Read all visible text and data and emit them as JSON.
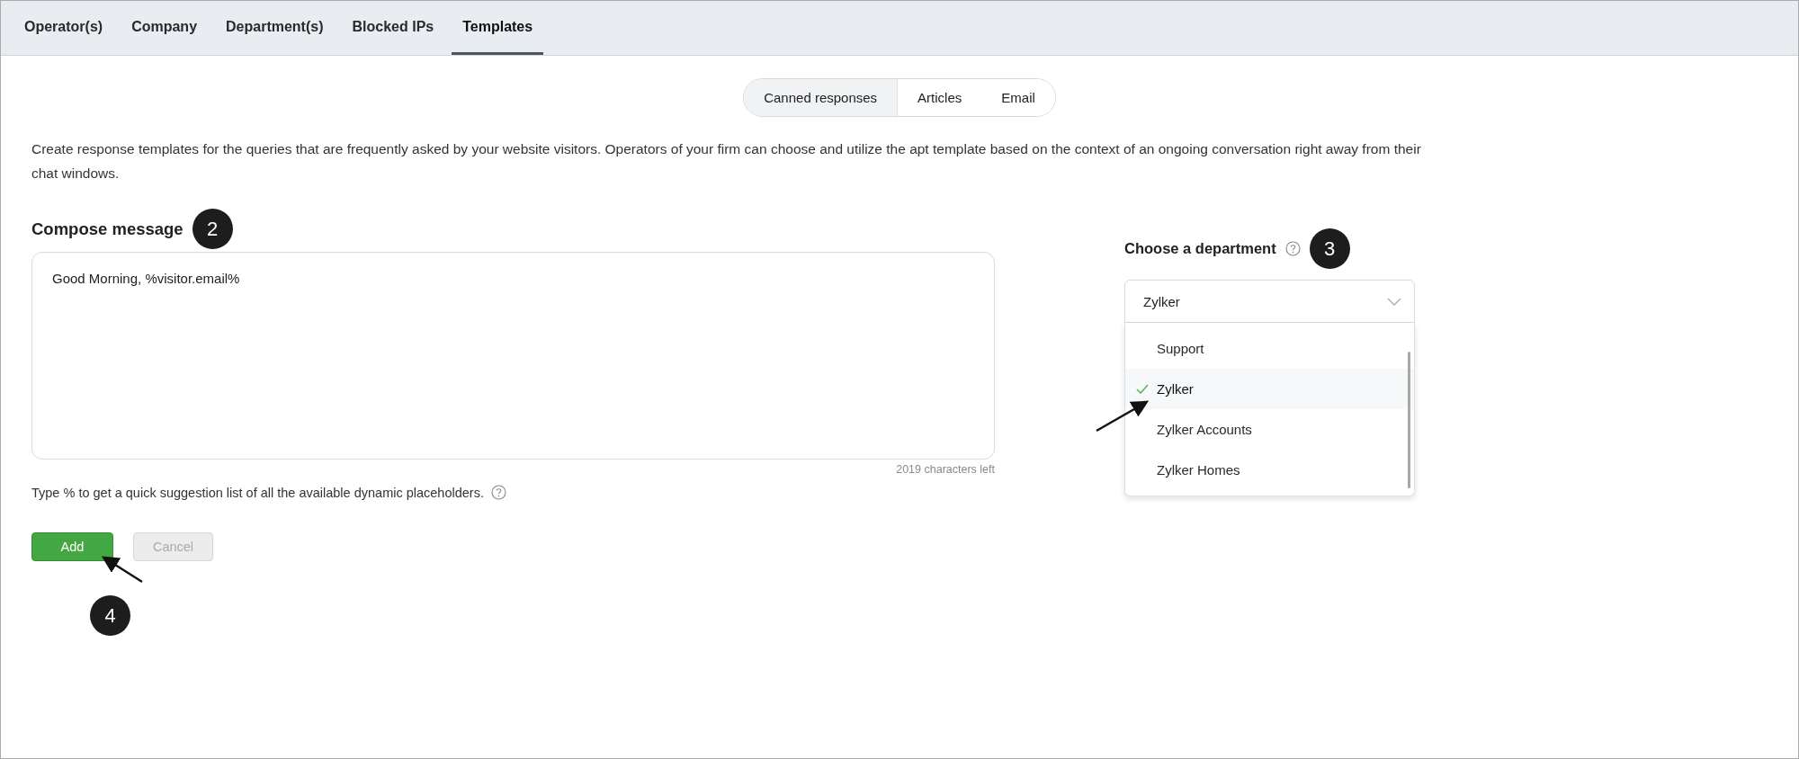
{
  "tabs": [
    {
      "label": "Operator(s)",
      "selected": false
    },
    {
      "label": "Company",
      "selected": false
    },
    {
      "label": "Department(s)",
      "selected": false
    },
    {
      "label": "Blocked IPs",
      "selected": false
    },
    {
      "label": "Templates",
      "selected": true
    }
  ],
  "segments": [
    {
      "label": "Canned responses",
      "selected": true
    },
    {
      "label": "Articles",
      "selected": false
    },
    {
      "label": "Email",
      "selected": false
    }
  ],
  "description": "Create response templates for the queries that are frequently asked by your website visitors. Operators of your firm can choose and utilize the apt template based on the context of an ongoing conversation right away from their chat windows.",
  "compose": {
    "title": "Compose message",
    "badge": "2",
    "value": "Good Morning, %visitor.email%",
    "chars_left": "2019 characters left",
    "hint": "Type % to get a quick suggestion list of all the available dynamic placeholders."
  },
  "buttons": [
    {
      "label": "Add",
      "kind": "primary",
      "disabled": false
    },
    {
      "label": "Cancel",
      "kind": "secondary",
      "disabled": true
    }
  ],
  "add_badge": "4",
  "department": {
    "title": "Choose a department",
    "badge": "3",
    "value": "Zylker",
    "expanded": true,
    "options": [
      {
        "label": "Support",
        "selected": false
      },
      {
        "label": "Zylker",
        "selected": true
      },
      {
        "label": "Zylker Accounts",
        "selected": false
      },
      {
        "label": "Zylker Homes",
        "selected": false
      }
    ]
  }
}
